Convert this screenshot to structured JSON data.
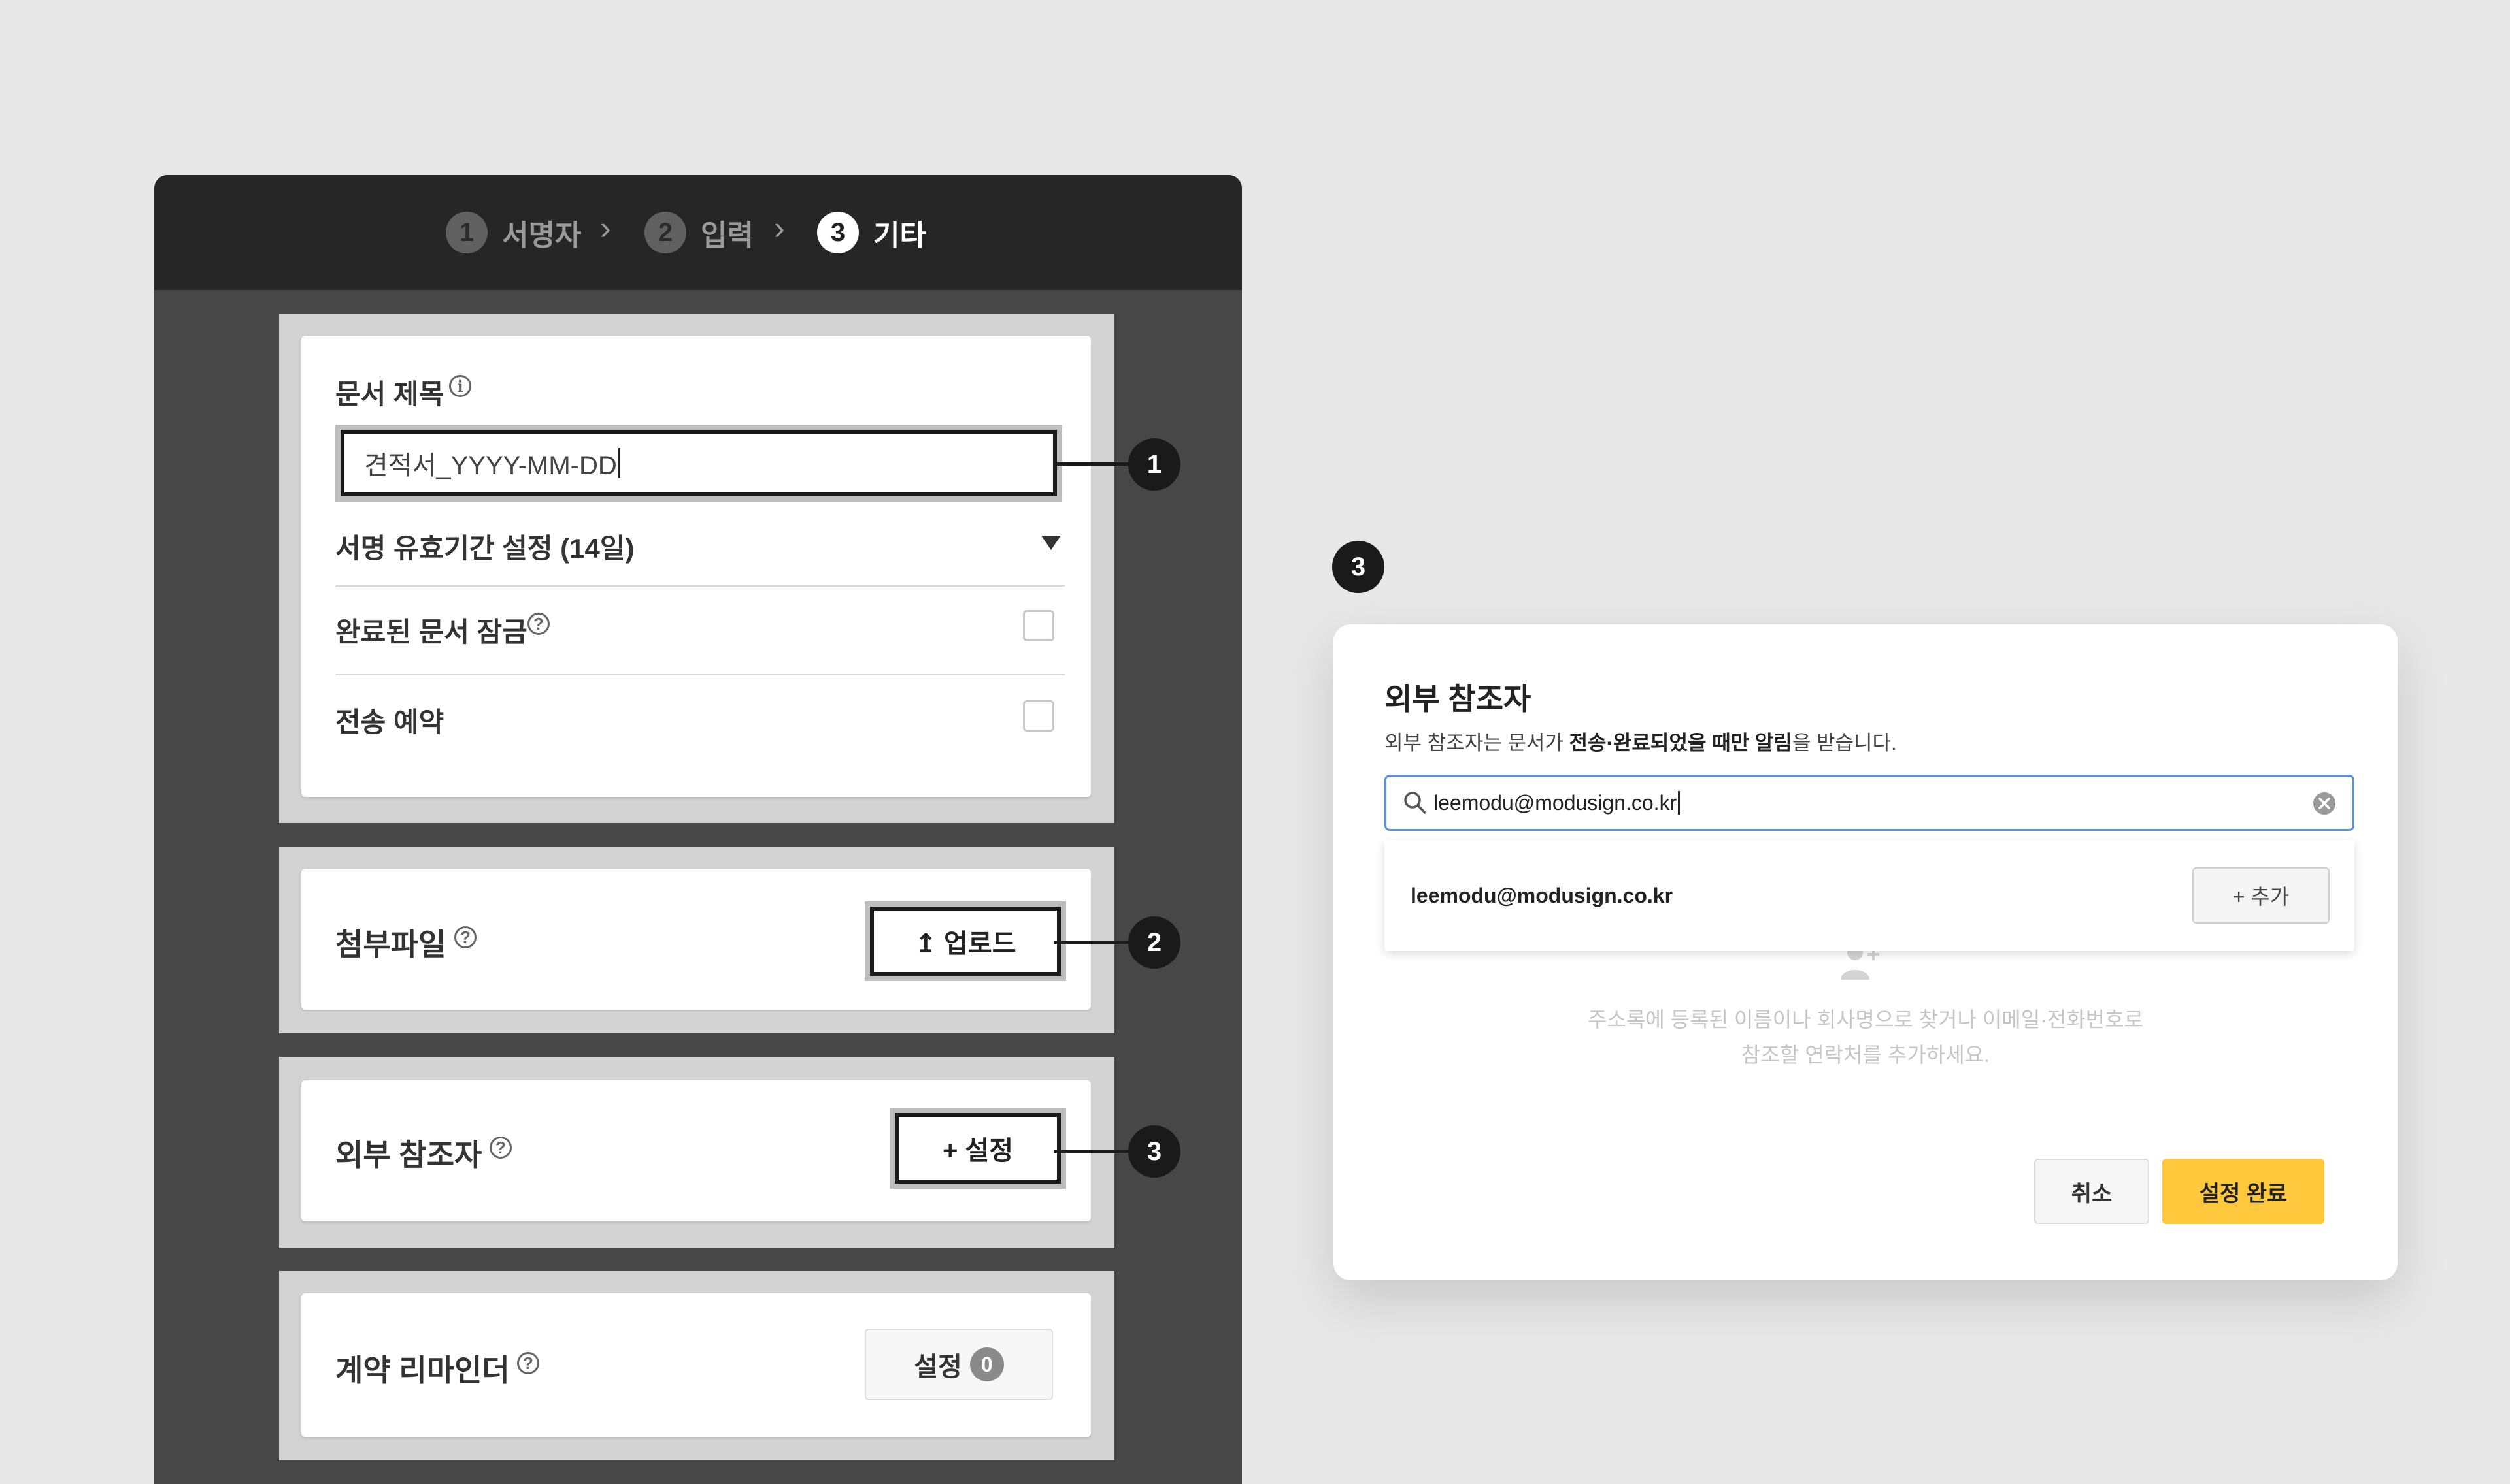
{
  "steps": [
    {
      "num": "1",
      "label": "서명자"
    },
    {
      "num": "2",
      "label": "입력"
    },
    {
      "num": "3",
      "label": "기타"
    }
  ],
  "doc_settings": {
    "title_label": "문서 제목",
    "title_value": "견적서_YYYY-MM-DD",
    "expiry_label": "서명 유효기간 설정 (14일)",
    "lock_label": "완료된 문서 잠금",
    "schedule_label": "전송 예약"
  },
  "attachment": {
    "label": "첨부파일",
    "button": "↥ 업로드"
  },
  "external_participants": {
    "label": "외부 참조자",
    "button": "+ 설정"
  },
  "reminder": {
    "label": "계약 리마인더",
    "button": "설정",
    "count": "0"
  },
  "callouts": [
    "1",
    "2",
    "3"
  ],
  "modal": {
    "callout": "3",
    "title": "외부 참조자",
    "desc_prefix": "외부 참조자는 문서가 ",
    "desc_bold": "전송·완료되었을 때만 알림",
    "desc_suffix": "을 받습니다.",
    "search_value": "leemodu@modusign.co.kr",
    "result_email": "leemodu@modusign.co.kr",
    "add_button": "+ 추가",
    "empty_line1": "주소록에 등록된 이름이나 회사명으로 찾거나 이메일·전화번호로",
    "empty_line2": "참조할 연락처를 추가하세요.",
    "cancel": "취소",
    "confirm": "설정 완료"
  }
}
